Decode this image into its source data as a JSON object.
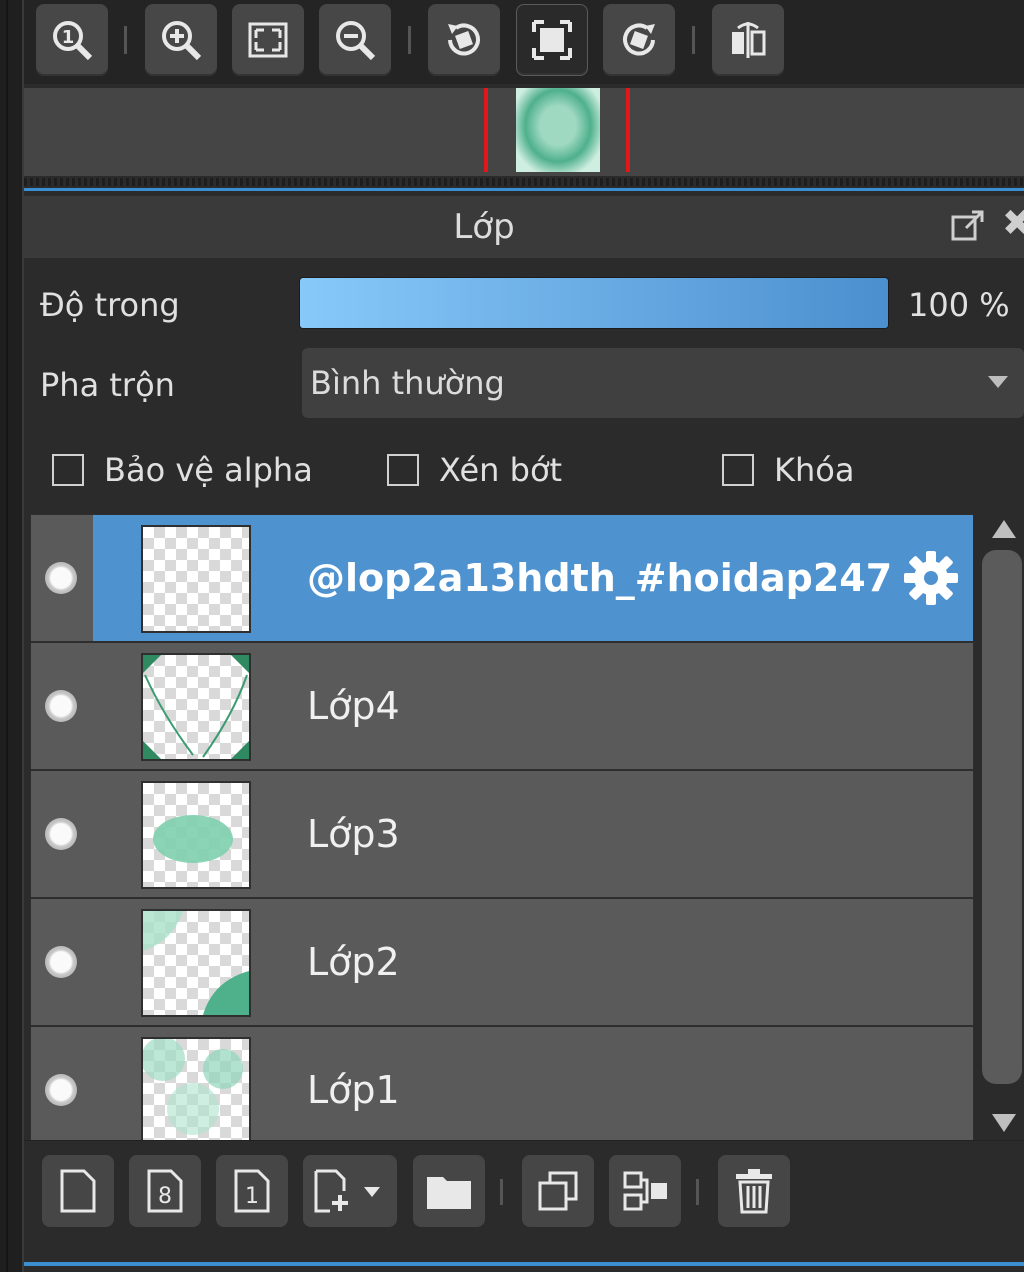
{
  "toolbar": {
    "buttons": [
      "zoom-actual-icon",
      "zoom-in-icon",
      "fit-window-icon",
      "zoom-out-icon",
      "rotate-left-icon",
      "fit-canvas-icon",
      "rotate-right-icon",
      "flip-horizontal-icon"
    ]
  },
  "panel": {
    "title": "Lớp"
  },
  "properties": {
    "opacity_label": "Độ trong",
    "opacity_value": "100 %",
    "opacity_fraction": 1.0,
    "blend_label": "Pha trộn",
    "blend_value": "Bình thường",
    "protect_alpha_label": "Bảo vệ alpha",
    "clipping_label": "Xén bớt",
    "lock_label": "Khóa"
  },
  "layers": [
    {
      "name": "@lop2a13hdth_#hoidap247",
      "active": true
    },
    {
      "name": "Lớp4",
      "active": false
    },
    {
      "name": "Lớp3",
      "active": false
    },
    {
      "name": "Lớp2",
      "active": false
    },
    {
      "name": "Lớp1",
      "active": false
    }
  ],
  "bottom_toolbar": {
    "buttons": [
      "new-layer-icon",
      "new-8bit-layer-icon",
      "new-1bit-layer-icon",
      "add-layer-menu-icon",
      "new-folder-icon",
      "duplicate-layer-icon",
      "merge-down-icon",
      "delete-layer-icon"
    ]
  },
  "colors": {
    "selection": "#4e93cf",
    "accent_line": "#3b8fd0",
    "navigator_frame": "#e01818"
  }
}
